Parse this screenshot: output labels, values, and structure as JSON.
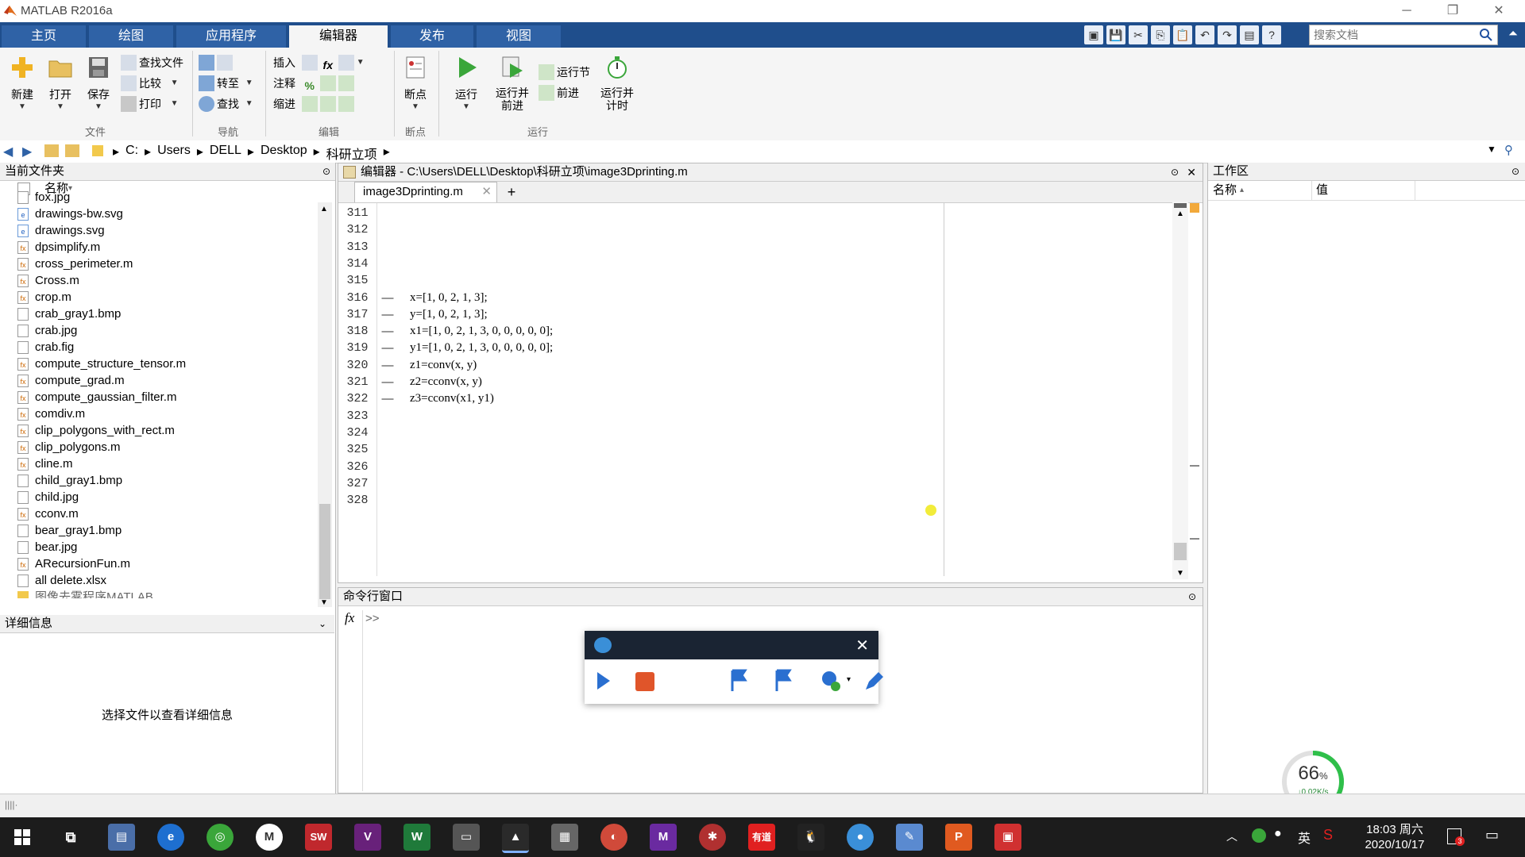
{
  "window": {
    "title": "MATLAB R2016a"
  },
  "tabs": [
    "主页",
    "绘图",
    "应用程序",
    "编辑器",
    "发布",
    "视图"
  ],
  "active_tab": "编辑器",
  "search": {
    "placeholder": "搜索文档"
  },
  "ribbon": {
    "new": "新建",
    "open": "打开",
    "save": "保存",
    "find_files": "查找文件",
    "compare": "比较",
    "print": "打印",
    "goto": "转至",
    "find": "查找",
    "insert": "插入",
    "comment": "注释",
    "indent": "缩进",
    "breakpoints": "断点",
    "run": "运行",
    "run_advance": "运行并\n前进",
    "run_section": "运行节",
    "advance": "前进",
    "run_time": "运行并\n计时",
    "groups": {
      "file": "文件",
      "nav": "导航",
      "edit": "编辑",
      "bp": "断点",
      "run": "运行"
    }
  },
  "address": {
    "parts": [
      "C:",
      "Users",
      "DELL",
      "Desktop",
      "科研立项"
    ]
  },
  "file_panel": {
    "title": "当前文件夹",
    "col_name": "名称",
    "files": [
      {
        "name": "fox.jpg",
        "type": "img"
      },
      {
        "name": "drawings-bw.svg",
        "type": "svg"
      },
      {
        "name": "drawings.svg",
        "type": "svg"
      },
      {
        "name": "dpsimplify.m",
        "type": "m"
      },
      {
        "name": "cross_perimeter.m",
        "type": "m"
      },
      {
        "name": "Cross.m",
        "type": "m"
      },
      {
        "name": "crop.m",
        "type": "m"
      },
      {
        "name": "crab_gray1.bmp",
        "type": "img"
      },
      {
        "name": "crab.jpg",
        "type": "img"
      },
      {
        "name": "crab.fig",
        "type": "fig"
      },
      {
        "name": "compute_structure_tensor.m",
        "type": "m"
      },
      {
        "name": "compute_grad.m",
        "type": "m"
      },
      {
        "name": "compute_gaussian_filter.m",
        "type": "m"
      },
      {
        "name": "comdiv.m",
        "type": "m"
      },
      {
        "name": "clip_polygons_with_rect.m",
        "type": "m"
      },
      {
        "name": "clip_polygons.m",
        "type": "m"
      },
      {
        "name": "cline.m",
        "type": "m"
      },
      {
        "name": "child_gray1.bmp",
        "type": "img"
      },
      {
        "name": "child.jpg",
        "type": "img"
      },
      {
        "name": "cconv.m",
        "type": "m"
      },
      {
        "name": "bear_gray1.bmp",
        "type": "img"
      },
      {
        "name": "bear.jpg",
        "type": "img"
      },
      {
        "name": "ARecursionFun.m",
        "type": "m"
      },
      {
        "name": "all delete.xlsx",
        "type": "img"
      },
      {
        "name": "图像去雾程序MATLAB",
        "type": "fold"
      }
    ],
    "details_title": "详细信息",
    "details_text": "选择文件以查看详细信息"
  },
  "editor": {
    "title": "编辑器 - C:\\Users\\DELL\\Desktop\\科研立项\\image3Dprinting.m",
    "tab": "image3Dprinting.m",
    "lines": [
      {
        "n": "311",
        "code": "",
        "dash": ""
      },
      {
        "n": "312",
        "code": "",
        "dash": ""
      },
      {
        "n": "313",
        "code": "",
        "dash": ""
      },
      {
        "n": "314",
        "code": "",
        "dash": ""
      },
      {
        "n": "315",
        "code": "",
        "dash": ""
      },
      {
        "n": "316",
        "code": "x=[1, 0, 2, 1, 3];",
        "dash": "—"
      },
      {
        "n": "317",
        "code": "y=[1, 0, 2, 1, 3];",
        "dash": "—"
      },
      {
        "n": "318",
        "code": "x1=[1, 0, 2, 1, 3, 0, 0, 0, 0, 0];",
        "dash": "—"
      },
      {
        "n": "319",
        "code": "y1=[1, 0, 2, 1, 3, 0, 0, 0, 0, 0];",
        "dash": "—"
      },
      {
        "n": "320",
        "code": "z1=conv(x, y)",
        "dash": "—"
      },
      {
        "n": "321",
        "code": "z2=cconv(x, y)",
        "dash": "—"
      },
      {
        "n": "322",
        "code": "z3=cconv(x1, y1)",
        "dash": "—"
      },
      {
        "n": "323",
        "code": "",
        "dash": ""
      },
      {
        "n": "324",
        "code": "",
        "dash": ""
      },
      {
        "n": "325",
        "code": "",
        "dash": ""
      },
      {
        "n": "326",
        "code": "",
        "dash": ""
      },
      {
        "n": "327",
        "code": "",
        "dash": ""
      },
      {
        "n": "328",
        "code": "",
        "dash": ""
      }
    ]
  },
  "command": {
    "title": "命令行窗口",
    "prompt": ">>",
    "fx": "fx"
  },
  "workspace": {
    "title": "工作区",
    "col_name": "名称",
    "col_value": "值"
  },
  "network": {
    "percent": "66",
    "unit": "%",
    "speed": "↓0.02K/s"
  },
  "tray": {
    "lang": "英",
    "time": "18:03 周六",
    "date": "2020/10/17",
    "notif": "3"
  },
  "colors": {
    "tab_bg": "#1f4e8c",
    "accent": "#2f62a6"
  }
}
